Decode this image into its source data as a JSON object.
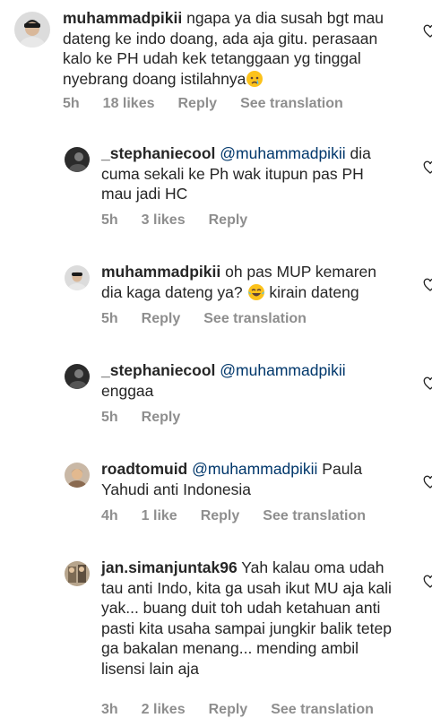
{
  "comments": [
    {
      "username": "muhammadpikii",
      "mention": "",
      "text": " ngapa ya dia susah bgt mau dateng ke indo doang, ada aja gitu. perasaan kalo ke PH udah kek tetanggaan yg tinggal nyebrang doang istilahnya",
      "emoji": "crying-face",
      "time": "5h",
      "likes": "18 likes",
      "reply": "Reply",
      "translate": "See translation"
    },
    {
      "username": "_stephaniecool",
      "mention": "@muhammadpikii",
      "text": " dia cuma sekali ke Ph wak itupun pas PH mau jadi HC",
      "time": "5h",
      "likes": "3 likes",
      "reply": "Reply",
      "translate": ""
    },
    {
      "username": "muhammadpikii",
      "mention": "",
      "text_a": " oh pas MUP kemaren dia kaga dateng ya? ",
      "emoji": "tears-of-joy",
      "text_b": " kirain dateng",
      "time": "5h",
      "likes": "",
      "reply": "Reply",
      "translate": "See translation"
    },
    {
      "username": "_stephaniecool",
      "mention": "@muhammadpikii",
      "text": " enggaa",
      "time": "5h",
      "likes": "",
      "reply": "Reply",
      "translate": ""
    },
    {
      "username": "roadtomuid",
      "mention": "@muhammadpikii",
      "text": " Paula Yahudi anti Indonesia",
      "time": "4h",
      "likes": "1 like",
      "reply": "Reply",
      "translate": "See translation"
    },
    {
      "username": "jan.simanjuntak96",
      "mention": "",
      "text": " Yah kalau oma udah tau anti Indo, kita ga usah ikut MU aja kali yak... buang duit toh udah ketahuan anti pasti kita usaha sampai jungkir balik tetep ga bakalan menang... mending ambil lisensi lain aja",
      "time": "3h",
      "likes": "2 likes",
      "reply": "Reply",
      "translate": "See translation"
    }
  ]
}
